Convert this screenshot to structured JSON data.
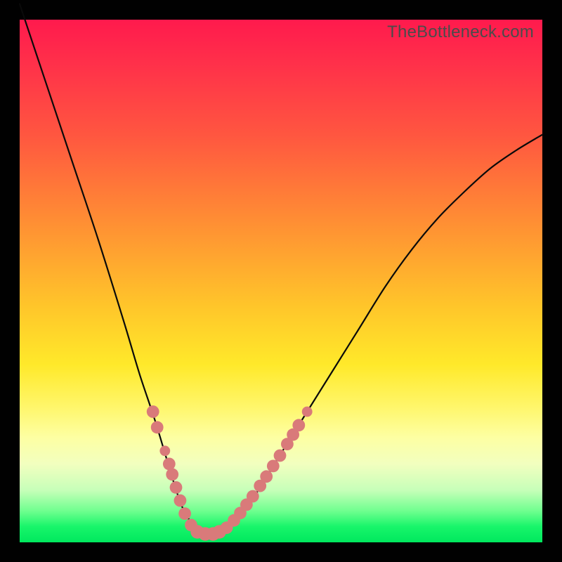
{
  "watermark": "TheBottleneck.com",
  "colors": {
    "background": "#000000",
    "gradient_top": "#ff1a4d",
    "gradient_mid": "#ffe92a",
    "gradient_bottom": "#00e85e",
    "curve": "#0a0a0a",
    "marker": "#d97a7a"
  },
  "chart_data": {
    "type": "line",
    "title": "",
    "xlabel": "",
    "ylabel": "",
    "xlim": [
      0,
      100
    ],
    "ylim": [
      0,
      100
    ],
    "annotations": [
      "TheBottleneck.com"
    ],
    "series": [
      {
        "name": "bottleneck-curve",
        "x": [
          0,
          5,
          10,
          15,
          20,
          23,
          26,
          29,
          31,
          33,
          35,
          37,
          40,
          45,
          50,
          55,
          60,
          65,
          70,
          75,
          80,
          85,
          90,
          95,
          100
        ],
        "y": [
          103,
          88,
          73,
          58,
          42,
          32,
          23,
          13,
          7,
          3.5,
          1.5,
          1.5,
          3,
          9,
          17,
          25,
          33,
          41,
          49,
          56,
          62,
          67,
          71.5,
          75,
          78
        ]
      }
    ],
    "markers": [
      {
        "x": 25.5,
        "y": 25,
        "r": 1.2
      },
      {
        "x": 26.3,
        "y": 22,
        "r": 1.2
      },
      {
        "x": 27.8,
        "y": 17.5,
        "r": 1.0
      },
      {
        "x": 28.6,
        "y": 15,
        "r": 1.2
      },
      {
        "x": 29.2,
        "y": 13,
        "r": 1.2
      },
      {
        "x": 29.9,
        "y": 10.5,
        "r": 1.2
      },
      {
        "x": 30.7,
        "y": 8,
        "r": 1.2
      },
      {
        "x": 31.6,
        "y": 5.5,
        "r": 1.2
      },
      {
        "x": 32.8,
        "y": 3.3,
        "r": 1.2
      },
      {
        "x": 34.0,
        "y": 2.0,
        "r": 1.3
      },
      {
        "x": 35.5,
        "y": 1.6,
        "r": 1.3
      },
      {
        "x": 37.0,
        "y": 1.6,
        "r": 1.3
      },
      {
        "x": 38.2,
        "y": 2.0,
        "r": 1.3
      },
      {
        "x": 39.6,
        "y": 2.8,
        "r": 1.2
      },
      {
        "x": 41.0,
        "y": 4.2,
        "r": 1.2
      },
      {
        "x": 42.2,
        "y": 5.6,
        "r": 1.2
      },
      {
        "x": 43.4,
        "y": 7.2,
        "r": 1.2
      },
      {
        "x": 44.6,
        "y": 8.8,
        "r": 1.2
      },
      {
        "x": 46.0,
        "y": 10.8,
        "r": 1.2
      },
      {
        "x": 47.2,
        "y": 12.6,
        "r": 1.2
      },
      {
        "x": 48.5,
        "y": 14.6,
        "r": 1.2
      },
      {
        "x": 49.8,
        "y": 16.6,
        "r": 1.2
      },
      {
        "x": 51.2,
        "y": 18.8,
        "r": 1.2
      },
      {
        "x": 52.3,
        "y": 20.6,
        "r": 1.2
      },
      {
        "x": 53.4,
        "y": 22.4,
        "r": 1.2
      },
      {
        "x": 55.0,
        "y": 25.0,
        "r": 1.0
      }
    ]
  }
}
